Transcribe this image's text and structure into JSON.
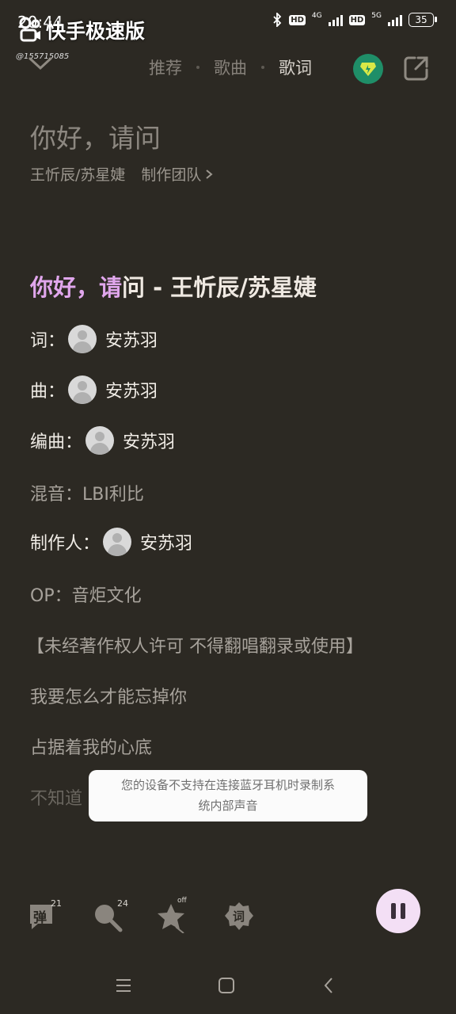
{
  "status_bar": {
    "time": "20:44",
    "net_4g": "4G",
    "net_5g": "5G",
    "hd": "HD",
    "battery": "35"
  },
  "watermark": {
    "app_title": "快手极速版",
    "user_id": "@155715085"
  },
  "header": {
    "tabs": [
      {
        "label": "推荐",
        "active": false
      },
      {
        "label": "歌曲",
        "active": false
      },
      {
        "label": "歌词",
        "active": true
      }
    ]
  },
  "song": {
    "title": "你好，请问",
    "artists": "王忻辰/苏星婕",
    "team_link": "制作团队"
  },
  "lyrics": {
    "head_hl": "你好，请",
    "head_rest": "问 - 王忻辰/苏星婕",
    "credits": [
      {
        "label": "词：",
        "name": "安苏羽"
      },
      {
        "label": "曲：",
        "name": "安苏羽"
      },
      {
        "label": "编曲：",
        "name": "安苏羽"
      },
      {
        "label": "混音：LBI利比"
      },
      {
        "label": "制作人：",
        "name": "安苏羽"
      },
      {
        "label": "OP：音炬文化"
      },
      {
        "label": "【未经著作权人许可 不得翻唱翻录或使用】"
      }
    ],
    "lines": [
      "我要怎么才能忘掉你",
      "占据着我的心底",
      "不知道"
    ]
  },
  "toast": {
    "line1": "您的设备不支持在连接蓝牙耳机时录制系",
    "line2": "统内部声音"
  },
  "controls": {
    "danmu_label": "弹",
    "danmu_count": "21",
    "comment_count": "24",
    "fav_state": "off",
    "lyric_label": "词"
  },
  "icons": [
    "chevron-down-icon",
    "vip-diamond-icon",
    "share-icon",
    "danmu-icon",
    "comment-icon",
    "star-icon",
    "lyric-badge-icon",
    "pause-icon",
    "menu-icon",
    "home-icon",
    "back-icon"
  ],
  "colors": {
    "background": "#2c2923",
    "highlight": "#e0a6ec",
    "vip": "#1f8e68",
    "play_button": "#f3dff5"
  }
}
